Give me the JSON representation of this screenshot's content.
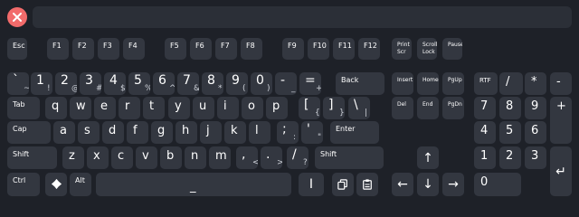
{
  "close_icon": "close-icon",
  "text_display": "",
  "function_row": [
    "Esc",
    "F1",
    "F2",
    "F3",
    "F4",
    "F5",
    "F6",
    "F7",
    "F8",
    "F9",
    "F10",
    "F11",
    "F12"
  ],
  "system_keys": [
    "Print\nScr",
    "Scroll\nLock",
    "Pause"
  ],
  "number_row": [
    {
      "shift": "~",
      "base": "`"
    },
    {
      "shift": "!",
      "base": "1"
    },
    {
      "shift": "@",
      "base": "2"
    },
    {
      "shift": "#",
      "base": "3"
    },
    {
      "shift": "$",
      "base": "4"
    },
    {
      "shift": "%",
      "base": "5"
    },
    {
      "shift": "^",
      "base": "6"
    },
    {
      "shift": "&",
      "base": "7"
    },
    {
      "shift": "*",
      "base": "8"
    },
    {
      "shift": "(",
      "base": "9"
    },
    {
      "shift": ")",
      "base": "0"
    },
    {
      "shift": "_",
      "base": "-"
    },
    {
      "shift": "+",
      "base": "="
    }
  ],
  "back_label": "Back",
  "tab_label": "Tab",
  "qwerty_row": [
    "q",
    "w",
    "e",
    "r",
    "t",
    "y",
    "u",
    "i",
    "o",
    "p"
  ],
  "bracket_keys": [
    {
      "shift": "[",
      "base": "{"
    },
    {
      "shift": "]",
      "base": "}"
    },
    {
      "shift": "\\",
      "base": "|"
    }
  ],
  "caps_label": "Cap",
  "home_row": [
    "a",
    "s",
    "d",
    "f",
    "g",
    "h",
    "j",
    "k",
    "l"
  ],
  "semicolon_keys": [
    {
      "shift": ";",
      "base": ":"
    },
    {
      "shift": "'",
      "base": "\""
    }
  ],
  "enter_label": "Enter",
  "shift_label": "Shift",
  "bottom_letter_row": [
    "z",
    "x",
    "c",
    "v",
    "b",
    "n",
    "m"
  ],
  "punct_keys": [
    {
      "shift": ",",
      "base": "<"
    },
    {
      "shift": ".",
      "base": ">"
    },
    {
      "shift": "/",
      "base": "?"
    }
  ],
  "right_shift_label": "Shift",
  "ctrl_label": "Ctrl",
  "alt_label": "Alt",
  "space_label": "_",
  "cursor_label": "I",
  "nav_cluster": [
    "Insert",
    "Home",
    "PgUp",
    "Del",
    "End",
    "PgDn"
  ],
  "arrows": {
    "up": "↑",
    "left": "←",
    "down": "↓",
    "right": "→"
  },
  "numpad_top": [
    "RTF",
    "/",
    "*",
    "-"
  ],
  "numpad_digits": [
    "7",
    "8",
    "9",
    "4",
    "5",
    "6",
    "1",
    "2",
    "3",
    "0"
  ],
  "numpad_plus": "+",
  "numpad_enter": "↵"
}
